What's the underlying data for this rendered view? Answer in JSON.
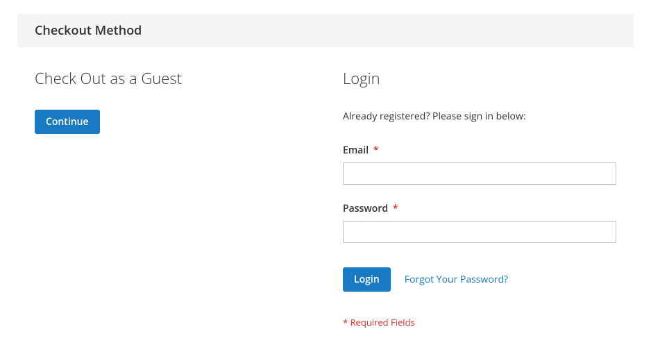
{
  "header": {
    "title": "Checkout Method"
  },
  "guest": {
    "title": "Check Out as a Guest",
    "continue_label": "Continue"
  },
  "login": {
    "title": "Login",
    "note": "Already registered? Please sign in below:",
    "email_label": "Email",
    "password_label": "Password",
    "login_label": "Login",
    "forgot_label": "Forgot Your Password?",
    "required_note": "* Required Fields",
    "asterisk": "*"
  }
}
